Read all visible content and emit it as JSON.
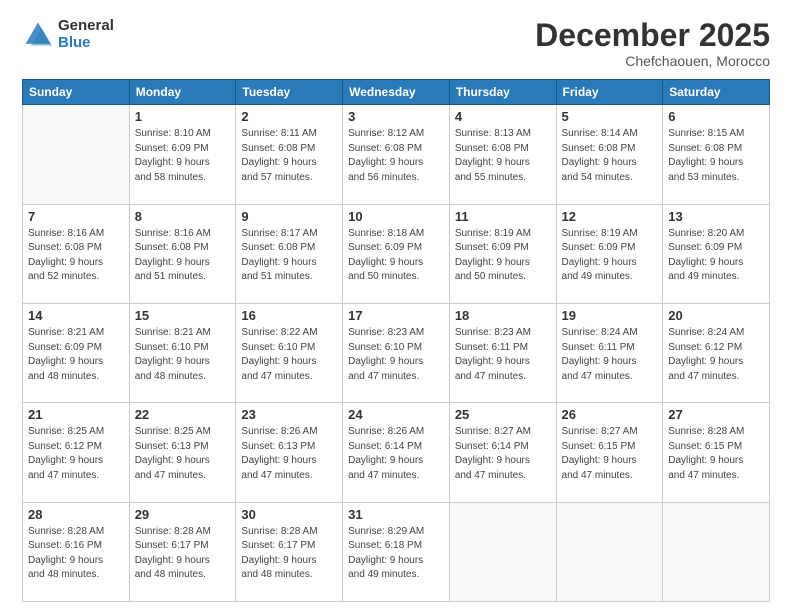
{
  "logo": {
    "general": "General",
    "blue": "Blue"
  },
  "title": "December 2025",
  "subtitle": "Chefchaouen, Morocco",
  "days_of_week": [
    "Sunday",
    "Monday",
    "Tuesday",
    "Wednesday",
    "Thursday",
    "Friday",
    "Saturday"
  ],
  "weeks": [
    [
      {
        "day": "",
        "info": ""
      },
      {
        "day": "1",
        "info": "Sunrise: 8:10 AM\nSunset: 6:09 PM\nDaylight: 9 hours\nand 58 minutes."
      },
      {
        "day": "2",
        "info": "Sunrise: 8:11 AM\nSunset: 6:08 PM\nDaylight: 9 hours\nand 57 minutes."
      },
      {
        "day": "3",
        "info": "Sunrise: 8:12 AM\nSunset: 6:08 PM\nDaylight: 9 hours\nand 56 minutes."
      },
      {
        "day": "4",
        "info": "Sunrise: 8:13 AM\nSunset: 6:08 PM\nDaylight: 9 hours\nand 55 minutes."
      },
      {
        "day": "5",
        "info": "Sunrise: 8:14 AM\nSunset: 6:08 PM\nDaylight: 9 hours\nand 54 minutes."
      },
      {
        "day": "6",
        "info": "Sunrise: 8:15 AM\nSunset: 6:08 PM\nDaylight: 9 hours\nand 53 minutes."
      }
    ],
    [
      {
        "day": "7",
        "info": "Sunrise: 8:16 AM\nSunset: 6:08 PM\nDaylight: 9 hours\nand 52 minutes."
      },
      {
        "day": "8",
        "info": "Sunrise: 8:16 AM\nSunset: 6:08 PM\nDaylight: 9 hours\nand 51 minutes."
      },
      {
        "day": "9",
        "info": "Sunrise: 8:17 AM\nSunset: 6:08 PM\nDaylight: 9 hours\nand 51 minutes."
      },
      {
        "day": "10",
        "info": "Sunrise: 8:18 AM\nSunset: 6:09 PM\nDaylight: 9 hours\nand 50 minutes."
      },
      {
        "day": "11",
        "info": "Sunrise: 8:19 AM\nSunset: 6:09 PM\nDaylight: 9 hours\nand 50 minutes."
      },
      {
        "day": "12",
        "info": "Sunrise: 8:19 AM\nSunset: 6:09 PM\nDaylight: 9 hours\nand 49 minutes."
      },
      {
        "day": "13",
        "info": "Sunrise: 8:20 AM\nSunset: 6:09 PM\nDaylight: 9 hours\nand 49 minutes."
      }
    ],
    [
      {
        "day": "14",
        "info": "Sunrise: 8:21 AM\nSunset: 6:09 PM\nDaylight: 9 hours\nand 48 minutes."
      },
      {
        "day": "15",
        "info": "Sunrise: 8:21 AM\nSunset: 6:10 PM\nDaylight: 9 hours\nand 48 minutes."
      },
      {
        "day": "16",
        "info": "Sunrise: 8:22 AM\nSunset: 6:10 PM\nDaylight: 9 hours\nand 47 minutes."
      },
      {
        "day": "17",
        "info": "Sunrise: 8:23 AM\nSunset: 6:10 PM\nDaylight: 9 hours\nand 47 minutes."
      },
      {
        "day": "18",
        "info": "Sunrise: 8:23 AM\nSunset: 6:11 PM\nDaylight: 9 hours\nand 47 minutes."
      },
      {
        "day": "19",
        "info": "Sunrise: 8:24 AM\nSunset: 6:11 PM\nDaylight: 9 hours\nand 47 minutes."
      },
      {
        "day": "20",
        "info": "Sunrise: 8:24 AM\nSunset: 6:12 PM\nDaylight: 9 hours\nand 47 minutes."
      }
    ],
    [
      {
        "day": "21",
        "info": "Sunrise: 8:25 AM\nSunset: 6:12 PM\nDaylight: 9 hours\nand 47 minutes."
      },
      {
        "day": "22",
        "info": "Sunrise: 8:25 AM\nSunset: 6:13 PM\nDaylight: 9 hours\nand 47 minutes."
      },
      {
        "day": "23",
        "info": "Sunrise: 8:26 AM\nSunset: 6:13 PM\nDaylight: 9 hours\nand 47 minutes."
      },
      {
        "day": "24",
        "info": "Sunrise: 8:26 AM\nSunset: 6:14 PM\nDaylight: 9 hours\nand 47 minutes."
      },
      {
        "day": "25",
        "info": "Sunrise: 8:27 AM\nSunset: 6:14 PM\nDaylight: 9 hours\nand 47 minutes."
      },
      {
        "day": "26",
        "info": "Sunrise: 8:27 AM\nSunset: 6:15 PM\nDaylight: 9 hours\nand 47 minutes."
      },
      {
        "day": "27",
        "info": "Sunrise: 8:28 AM\nSunset: 6:15 PM\nDaylight: 9 hours\nand 47 minutes."
      }
    ],
    [
      {
        "day": "28",
        "info": "Sunrise: 8:28 AM\nSunset: 6:16 PM\nDaylight: 9 hours\nand 48 minutes."
      },
      {
        "day": "29",
        "info": "Sunrise: 8:28 AM\nSunset: 6:17 PM\nDaylight: 9 hours\nand 48 minutes."
      },
      {
        "day": "30",
        "info": "Sunrise: 8:28 AM\nSunset: 6:17 PM\nDaylight: 9 hours\nand 48 minutes."
      },
      {
        "day": "31",
        "info": "Sunrise: 8:29 AM\nSunset: 6:18 PM\nDaylight: 9 hours\nand 49 minutes."
      },
      {
        "day": "",
        "info": ""
      },
      {
        "day": "",
        "info": ""
      },
      {
        "day": "",
        "info": ""
      }
    ]
  ]
}
